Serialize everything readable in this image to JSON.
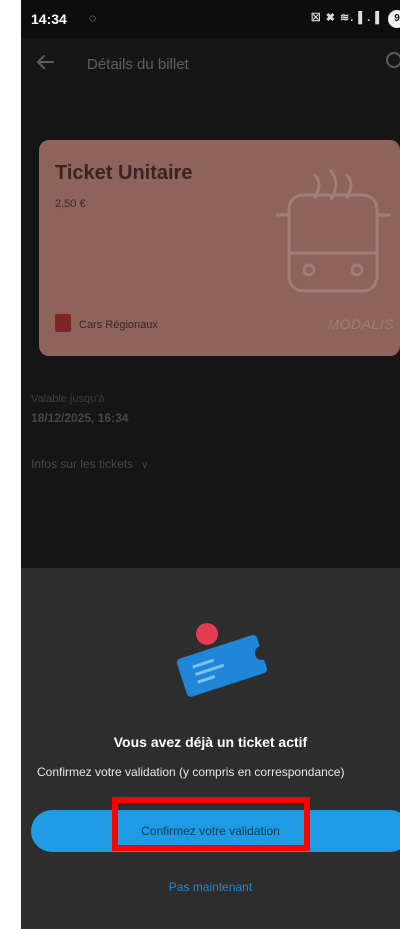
{
  "status_bar": {
    "time": "14:34",
    "status_glyph": "◌",
    "icons": "☒ ✖ ≋.▐ .▐",
    "battery": "9"
  },
  "app_bar": {
    "title": "Détails du billet"
  },
  "ticket": {
    "title": "Ticket Unitaire",
    "price": "2,50 €",
    "operator": "Cars Régionaux",
    "brand": "MODALIS",
    "background": "#8e635a"
  },
  "validity": {
    "label": "Valable jusqu'à",
    "value": "18/12/2025, 16:34"
  },
  "info_link": {
    "label": "Infos sur les tickets",
    "chevron": "∨"
  },
  "sheet": {
    "title": "Vous avez déjà un ticket actif",
    "subtitle": "Confirmez votre validation (y compris en correspondance)",
    "confirm_label": "Confirmez votre validation",
    "later_label": "Pas maintenant",
    "accent": "#1f9be3",
    "highlight": "#ff0000"
  }
}
